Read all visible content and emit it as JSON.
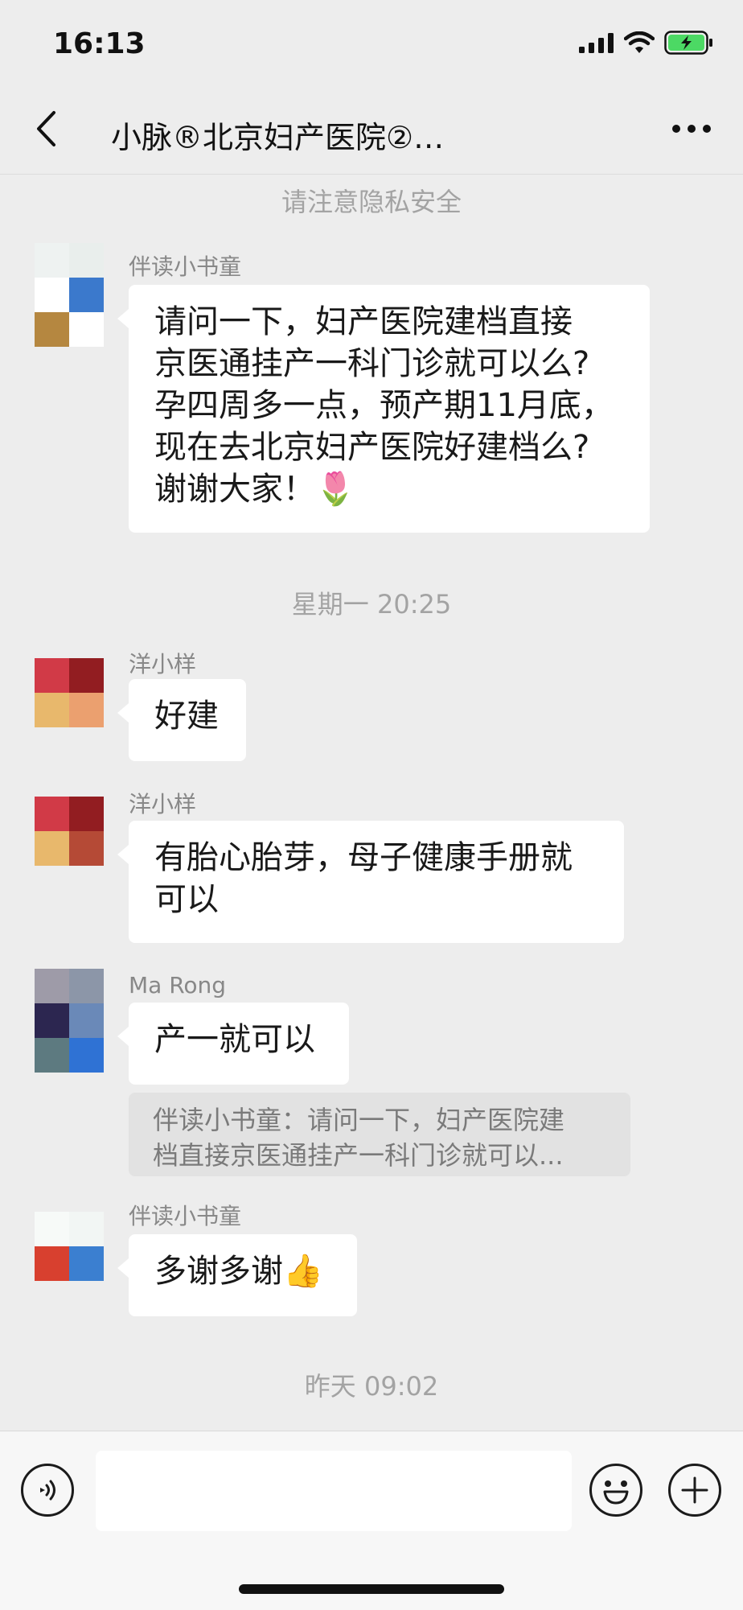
{
  "status_bar": {
    "time": "16:13"
  },
  "nav": {
    "title": "小脉®北京妇产医院②…"
  },
  "notices": {
    "privacy": "请注意隐私安全",
    "ts1": "星期一 20:25",
    "ts2": "昨天 09:02"
  },
  "messages": {
    "m1": {
      "sender": "伴读小书童",
      "lines": [
        "请问一下，妇产医院建档直接",
        "京医通挂产一科门诊就可以么?",
        "孕四周多一点，预产期11月底，",
        "现在去北京妇产医院好建档么?",
        "谢谢大家！🌷"
      ]
    },
    "m2": {
      "sender": "洋小样",
      "text": "好建"
    },
    "m3": {
      "sender": "洋小样",
      "lines": [
        "有胎心胎芽，母子健康手册就",
        "可以"
      ]
    },
    "m4": {
      "sender": "Ma Rong",
      "text": "产一就可以",
      "quote_lines": [
        "伴读小书童：请问一下，妇产医院建",
        "档直接京医通挂产一科门诊就可以..."
      ]
    },
    "m5": {
      "sender": "伴读小书童",
      "text": "多谢多谢👍"
    }
  },
  "icons": {
    "back": "chevron-left-icon",
    "more": "more-dots-icon",
    "voice": "voice-icon",
    "emoji": "emoji-icon",
    "plus": "plus-icon",
    "signal": "signal-icon",
    "wifi": "wifi-icon",
    "battery": "battery-charging-icon"
  },
  "colors": {
    "background": "#ededed",
    "bubble": "#ffffff",
    "battery": "#4cd964"
  }
}
